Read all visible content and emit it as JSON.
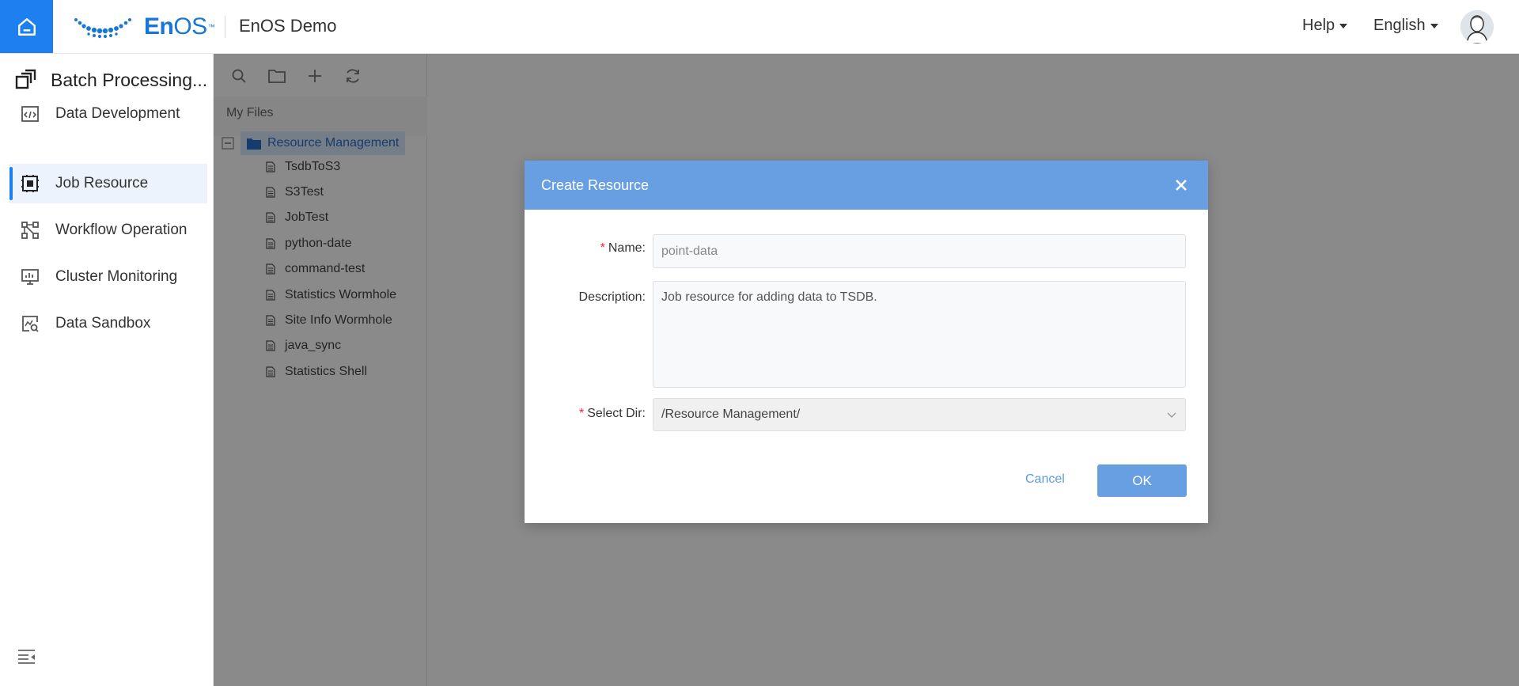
{
  "header": {
    "brand": "EnOS",
    "brand_tm": "™",
    "org_name": "EnOS Demo",
    "help_label": "Help",
    "language_label": "English"
  },
  "sidebar": {
    "app_title": "Batch Processing...",
    "items": [
      {
        "label": "Data Development",
        "icon": "data-development-icon",
        "active": false
      },
      {
        "label": "Job Resource",
        "icon": "job-resource-icon",
        "active": true
      },
      {
        "label": "Workflow Operation",
        "icon": "workflow-icon",
        "active": false
      },
      {
        "label": "Cluster Monitoring",
        "icon": "monitor-icon",
        "active": false
      },
      {
        "label": "Data Sandbox",
        "icon": "sandbox-icon",
        "active": false
      }
    ]
  },
  "file_panel": {
    "toolbar": [
      "search-icon",
      "folder-icon",
      "plus-icon",
      "refresh-icon"
    ],
    "section_label": "My Files",
    "root_folder": "Resource Management",
    "files": [
      "TsdbToS3",
      "S3Test",
      "JobTest",
      "python-date",
      "command-test",
      "Statistics Wormhole",
      "Site Info Wormhole",
      "java_sync",
      "Statistics Shell"
    ]
  },
  "dialog": {
    "title": "Create Resource",
    "name_label": "Name:",
    "name_value": "point-data",
    "description_label": "Description:",
    "description_value": "Job resource for adding data to TSDB.",
    "dir_label": "Select Dir:",
    "dir_value": "/Resource Management/",
    "cancel_label": "Cancel",
    "ok_label": "OK"
  },
  "colors": {
    "primary": "#1e7ff0",
    "dialog_header": "#689fe3",
    "active_nav_bg": "#edf3fc",
    "required": "#f5222d"
  }
}
